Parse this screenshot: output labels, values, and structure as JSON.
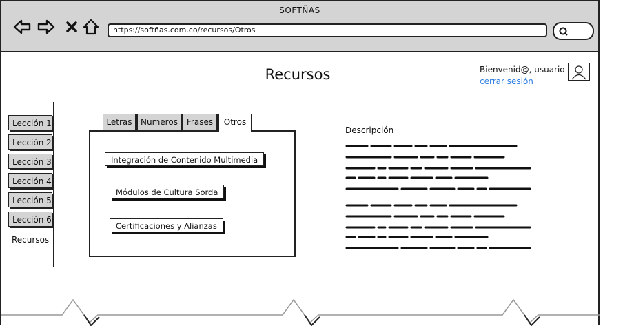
{
  "browser": {
    "window_title": "SOFTÑAS",
    "url": "https://softñas.com.co/recursos/Otros",
    "nav_icons": [
      "back-arrow-icon",
      "forward-arrow-icon",
      "close-icon",
      "home-icon"
    ]
  },
  "page": {
    "title": "Recursos"
  },
  "user": {
    "greeting": "Bienvenid@, usuario",
    "logout": "cerrar sesión"
  },
  "sidebar": {
    "items": [
      {
        "label": "Lección 1",
        "active": false
      },
      {
        "label": "Lección 2",
        "active": false
      },
      {
        "label": "Lección 3",
        "active": false
      },
      {
        "label": "Lección 4",
        "active": false
      },
      {
        "label": "Lección 5",
        "active": false
      },
      {
        "label": "Lección 6",
        "active": false
      },
      {
        "label": "Recursos",
        "active": true
      }
    ]
  },
  "tabs": {
    "items": [
      {
        "label": "Letras",
        "active": false
      },
      {
        "label": "Numeros",
        "active": false
      },
      {
        "label": "Frases",
        "active": false
      },
      {
        "label": "Otros",
        "active": true
      }
    ]
  },
  "resources": {
    "buttons": [
      {
        "label": "Integración de Contenido Multimedia"
      },
      {
        "label": "Módulos de Cultura Sorda"
      },
      {
        "label": "Certificaciones y Alianzas"
      }
    ]
  },
  "description": {
    "label": "Descripción"
  },
  "colors": {
    "chrome": "#d4d4d4",
    "link": "#2b7de1",
    "ink": "#222222"
  }
}
